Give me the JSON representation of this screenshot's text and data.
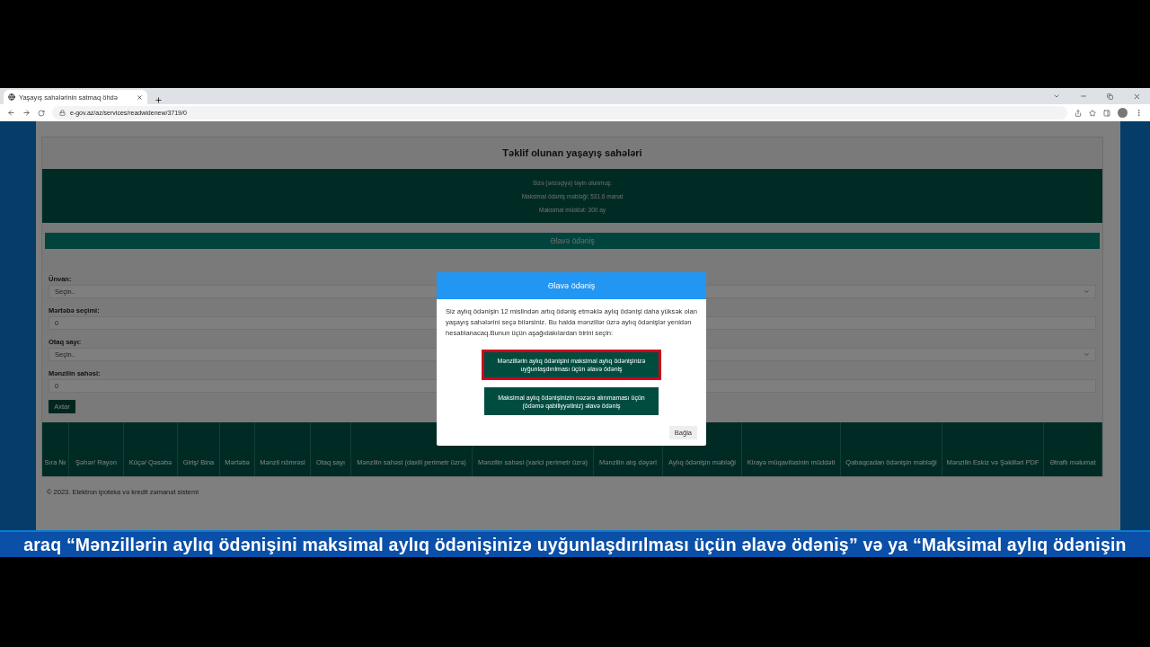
{
  "browser": {
    "tab_title": "Yaşayış sahələrinin satmaq öhdə",
    "url": "e-gov.az/az/services/readwidenew/3719/0"
  },
  "page": {
    "title": "Təklif olunan yaşayış sahələri",
    "info_lines": [
      "Sizə (ərizəçiyə) təyin olunmuş:",
      "Maksimal ödəniş məbləği: 531.6 manat",
      "Maksimal müddət: 300 ay"
    ],
    "extra_button": "Əlavə ödəniş",
    "filters": [
      {
        "kind": "select",
        "label": "Ünvan:",
        "value": "Seçin.."
      },
      {
        "kind": "input",
        "label": "Mərtəbə seçimi:",
        "value": "0"
      },
      {
        "kind": "select",
        "label": "Otaq sayı:",
        "value": "Seçin.."
      },
      {
        "kind": "input",
        "label": "Mənzilin sahəsi:",
        "value": "0"
      }
    ],
    "search_button": "Axtar",
    "table": {
      "columns": [
        "Sıra №",
        "Şəhər/ Rayon",
        "Küçə/ Qəsəbə",
        "Giriş/ Bina",
        "Mərtəbə",
        "Mənzil nömrəsi",
        "Otaq sayı",
        "Mənzilin sahəsi (daxili perimetr üzrə)",
        "Mənzilin sahəsi (xarici perimetr üzrə)",
        "Mənzilin alış dəyəri",
        "Aylıq ödənişin məbləği",
        "Kirayə müqaviləsinin müddəti",
        "Qabaqcadan ödənişin məbləği",
        "Mənzilin Eskiz və Şəkilləri PDF",
        "Ətraflı məlumat"
      ]
    },
    "footer": "© 2023. Elektron ipoteka və kredit zəmanət sistemi"
  },
  "modal": {
    "title": "Əlavə ödəniş",
    "text": "Siz aylıq ödənişin 12 mislindən artıq ödəniş etməklə aylıq ödənişi daha yüksək olan yaşayış sahələrini seçə bilərsiniz. Bu halda mənzillər üzrə aylıq ödənişlər yenidən hesablanacaq.Bunun üçün aşağıdakılardan birini seçin:",
    "options": [
      {
        "label": "Mənzillərin aylıq ödənişini maksimal aylıq ödənişinizə uyğunlaşdırılması üçün əlavə ödəniş",
        "selected": true
      },
      {
        "label": "Maksimal aylıq ödənişinizin nəzərə alınmaması üçün (ödəmə qabiliyyətiniz) əlavə ödəniş",
        "selected": false
      }
    ],
    "close_button": "Bağla"
  },
  "ticker": "araq “Mənzillərin aylıq ödənişini maksimal aylıq ödənişinizə uyğunlaşdırılması üçün əlavə ödəniş” və ya “Maksimal aylıq ödənişin"
}
